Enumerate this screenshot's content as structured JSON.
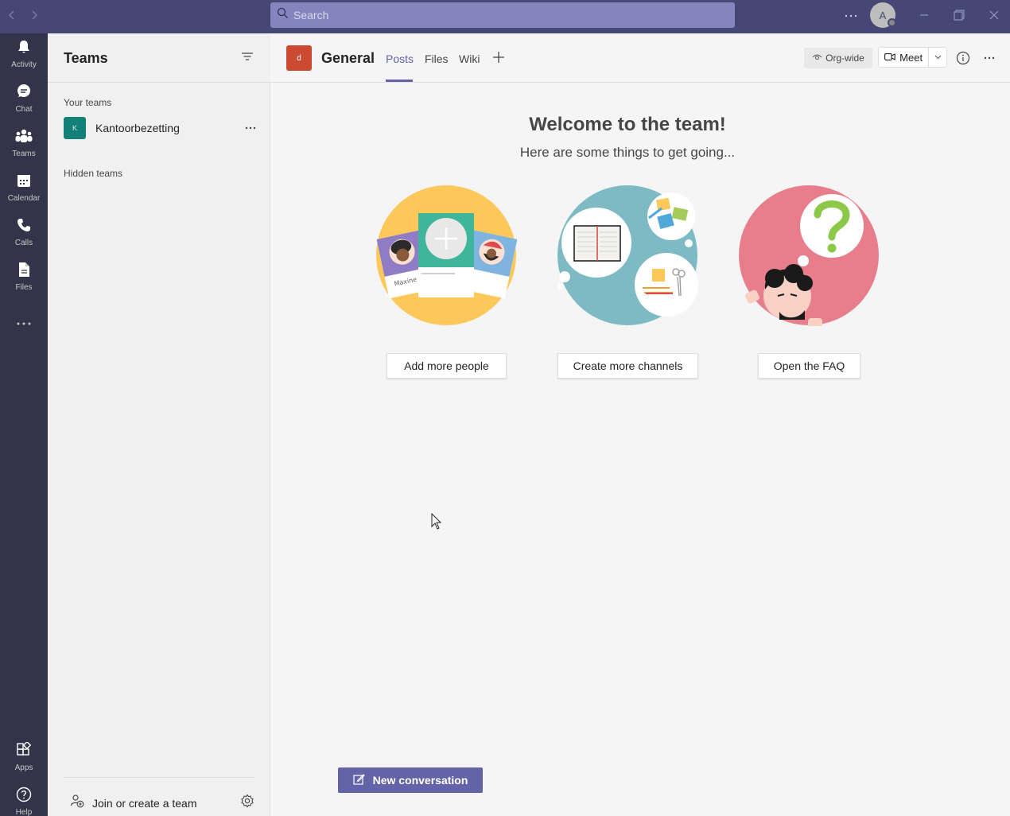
{
  "titlebar": {
    "search_placeholder": "Search",
    "avatar_initial": "A"
  },
  "appbar": {
    "items": [
      {
        "label": "Activity",
        "icon": "bell-icon"
      },
      {
        "label": "Chat",
        "icon": "chat-icon"
      },
      {
        "label": "Teams",
        "icon": "teams-icon"
      },
      {
        "label": "Calendar",
        "icon": "calendar-icon"
      },
      {
        "label": "Calls",
        "icon": "phone-icon"
      },
      {
        "label": "Files",
        "icon": "file-icon"
      },
      {
        "label": "Apps",
        "icon": "apps-icon"
      },
      {
        "label": "Help",
        "icon": "help-icon"
      }
    ]
  },
  "leftpanel": {
    "title": "Teams",
    "your_teams_label": "Your teams",
    "team": {
      "initial": "K",
      "name": "Kantoorbezetting",
      "color": "#138078"
    },
    "hidden_teams_label": "Hidden teams",
    "join_label": "Join or create a team"
  },
  "channel": {
    "avatar_initial": "d",
    "name": "General",
    "tabs": [
      "Posts",
      "Files",
      "Wiki"
    ],
    "active_tab": "Posts",
    "orgwide_label": "Org-wide",
    "meet_label": "Meet"
  },
  "main": {
    "welcome_title": "Welcome to the team!",
    "welcome_subtitle": "Here are some things to get going...",
    "cards": [
      {
        "button": "Add more people",
        "illustration_name": "Maxine"
      },
      {
        "button": "Create more channels"
      },
      {
        "button": "Open the FAQ"
      }
    ],
    "new_conversation_label": "New conversation"
  },
  "colors": {
    "titlebar": "#464775",
    "appbar": "#33344a",
    "accent": "#6264a7"
  }
}
